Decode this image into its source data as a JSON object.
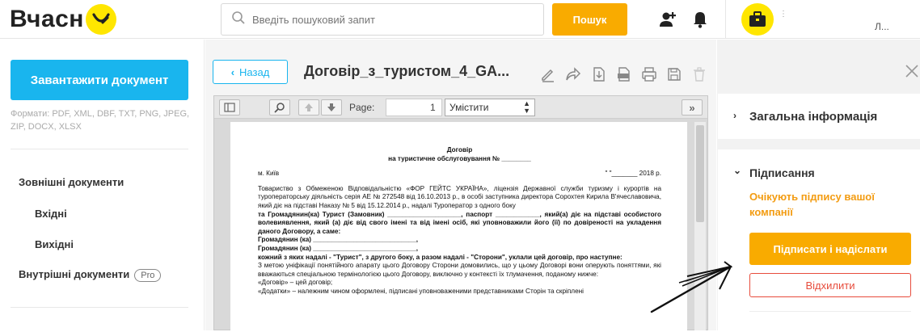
{
  "header": {
    "logo_text": "Вчасн",
    "search_placeholder": "Введіть пошуковий запит",
    "search_button": "Пошук",
    "user_label": "Л..."
  },
  "sidebar": {
    "upload_button": "Завантажити документ",
    "formats_text": "Формати: PDF, XML, DBF, TXT, PNG, JPEG, ZIP, DOCX, XLSX",
    "items": [
      {
        "label": "Зовнішні документи"
      },
      {
        "label": "Вхідні"
      },
      {
        "label": "Вихідні"
      },
      {
        "label": "Внутрішні документи",
        "badge": "Pro"
      }
    ]
  },
  "document": {
    "back_button": "Назад",
    "title": "Договір_з_туристом_4_GA...",
    "viewer": {
      "page_label": "Page:",
      "page_value": "1",
      "zoom_value": "Умістити"
    },
    "content": {
      "heading": "Договір",
      "subheading": "на туристичне обслуговування № ________",
      "city": "м. Київ",
      "date": "\"  \"_______ 2018 р.",
      "lines": [
        "Товариство з Обмеженою Відповідальністю «ФОР ГЕЙТС УКРАЇНА», ліцензія Державної служби туризму і курортів на туроператорську діяльність серія АЕ № 272548 від 16.10.2013 р., в особі заступника директора Сорохтея Кирила В'ячеславовича, який діє на підставі Наказу № 5 від 15.12.2014 р., надалі Туроператор з одного боку",
        "та Громадянин(ка) Турист (Замовник) ____________________, паспорт ____________, який(а) діє на підставі особистого волевиявлення, який (а) діє від свого імені та від імені осіб, які уповноважили його (її) по довіреності на укладення даного Договору, а саме:",
        "Громадянин (ка) ____________________________,",
        "Громадянин (ка) ____________________________,",
        "кожний з яких надалі - \"Турист\", з другого боку, а разом надалі - \"Сторони\", уклали цей договір, про наступне:",
        "З метою уніфікації понятійного апарату цього Договору Сторони домовились, що у цьому Договорі вони оперують поняттями, які вважаються спеціальною термінологією цього Договору, виключно у контексті їх тлумачення, поданому нижче:",
        "«Договір» – цей договір;",
        "«Додатки» – належним чином оформлені, підписані уповноваженими представниками Сторін та скріплені"
      ]
    }
  },
  "panel": {
    "general_info": "Загальна інформація",
    "signing": "Підписання",
    "awaiting_text": "Очікують підпису вашої компанії",
    "sign_button": "Підписати і надіслати",
    "reject_button": "Відхилити"
  },
  "colors": {
    "accent_yellow": "#ffe600",
    "accent_orange": "#f9ab00",
    "accent_blue": "#19b5ee",
    "danger_red": "#e74c3c"
  }
}
